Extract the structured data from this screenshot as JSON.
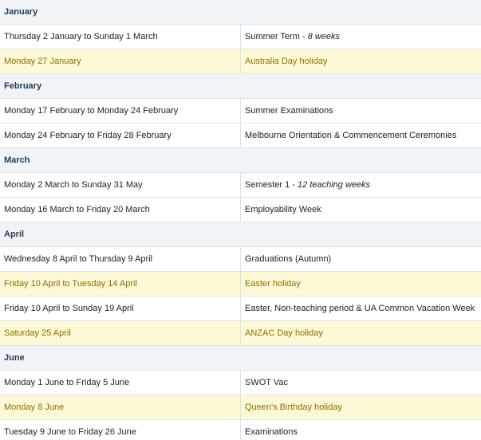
{
  "calendar": {
    "highlight_color": "#fdf9d6",
    "holiday_text_color": "#8a7000",
    "month_header_color": "#f1f4f7",
    "rows": [
      {
        "type": "month",
        "label": "January"
      },
      {
        "type": "event",
        "date": "Thursday 2 January to Sunday 1 March",
        "event": "Summer Term - ",
        "note": "8 weeks"
      },
      {
        "type": "holiday",
        "date": "Monday 27 January",
        "event": "Australia Day holiday"
      },
      {
        "type": "month",
        "label": "February"
      },
      {
        "type": "event",
        "date": "Monday 17 February to Monday 24 February",
        "event": "Summer Examinations"
      },
      {
        "type": "event",
        "date": "Monday 24 February to Friday 28 February",
        "event": "Melbourne Orientation & Commencement Ceremonies"
      },
      {
        "type": "month",
        "label": "March"
      },
      {
        "type": "event",
        "date": "Monday 2 March to Sunday 31 May",
        "event": "Semester 1 - ",
        "note": "12 teaching weeks"
      },
      {
        "type": "event",
        "date": "Monday 16 March to Friday 20 March",
        "event": "Employability Week"
      },
      {
        "type": "month",
        "label": "April"
      },
      {
        "type": "event",
        "date": "Wednesday 8 April to Thursday 9 April",
        "event": "Graduations (Autumn)"
      },
      {
        "type": "holiday",
        "date": "Friday 10 April to Tuesday 14 April",
        "event": "Easter holiday"
      },
      {
        "type": "event",
        "date": "Friday 10 April to Sunday 19 April",
        "event": "Easter, Non-teaching period & UA Common Vacation Week"
      },
      {
        "type": "holiday",
        "date": "Saturday 25 April",
        "event": "ANZAC Day holiday"
      },
      {
        "type": "month",
        "label": "June"
      },
      {
        "type": "event",
        "date": "Monday 1 June to Friday 5 June",
        "event": "SWOT Vac"
      },
      {
        "type": "holiday",
        "date": "Monday 8 June",
        "event": "Queen's Birthday holiday"
      },
      {
        "type": "event",
        "date": "Tuesday 9 June to Friday 26 June",
        "event": "Examinations"
      }
    ]
  }
}
